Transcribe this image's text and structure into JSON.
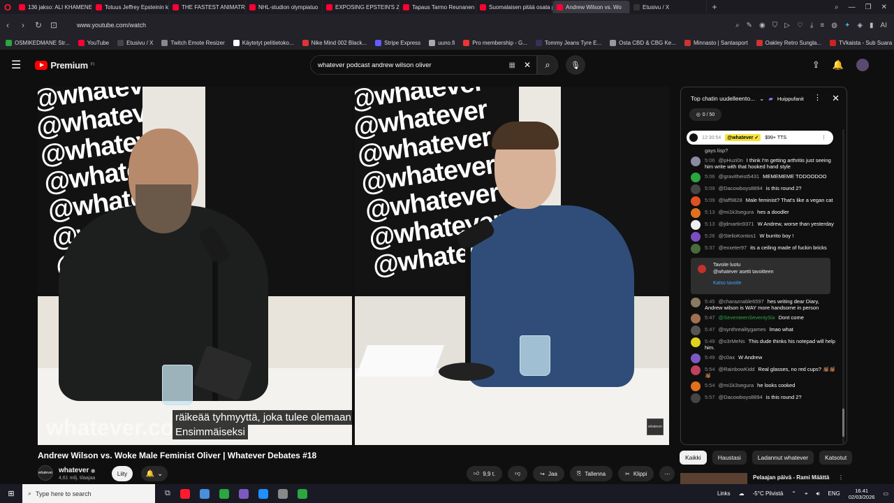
{
  "browser": {
    "tabs": [
      {
        "label": "136 jakso: ALI KHAMENEI",
        "color": "#ff0033"
      },
      {
        "label": "Totuus Jeffrey Epsteinin k",
        "color": "#ff0033"
      },
      {
        "label": "THE FASTEST ANIMATRONI",
        "color": "#ff0033"
      },
      {
        "label": "NHL-studion olympiatuo",
        "color": "#ff0033"
      },
      {
        "label": "EXPOSING EPSTEIN'S ZOR",
        "color": "#ff0033"
      },
      {
        "label": "Tapaus Tarmo Reunanen ja",
        "color": "#ff0033"
      },
      {
        "label": "Suomalaisen pitää osata p",
        "color": "#ff0033"
      },
      {
        "label": "Andrew Wilson vs. Wo",
        "color": "#ff0033",
        "active": true
      },
      {
        "label": "Etusivu / X",
        "color": "#333"
      }
    ],
    "url": "www.youtube.com/watch",
    "bookmarks": [
      {
        "label": "OSMIKEDMANE Str...",
        "color": "#2ba640"
      },
      {
        "label": "YouTube",
        "color": "#ff0033"
      },
      {
        "label": "Etusivu / X",
        "color": "#444"
      },
      {
        "label": "Twitch Emote Resizer",
        "color": "#888"
      },
      {
        "label": "Käytetyt pelitietoko...",
        "color": "#fff"
      },
      {
        "label": "Nike Mind 002 Black...",
        "color": "#d33"
      },
      {
        "label": "Stripe Express",
        "color": "#635bff"
      },
      {
        "label": "uuno.fi",
        "color": "#aaa"
      },
      {
        "label": "Pro membership - G...",
        "color": "#e33"
      },
      {
        "label": "Tommy Jeans Tyre E...",
        "color": "#335"
      },
      {
        "label": "Osta CBD & CBG Ke...",
        "color": "#999"
      },
      {
        "label": "Minnasto | Santasport",
        "color": "#c33"
      },
      {
        "label": "Oakley Retro Sungla...",
        "color": "#c33"
      },
      {
        "label": "TVkaista - Sub Suara",
        "color": "#c22"
      }
    ]
  },
  "youtube": {
    "logo": "Premium",
    "logo_sup": "FI",
    "search_value": "whatever podcast andrew wilson oliver"
  },
  "video": {
    "caption_line1": "räikeää tyhmyyttä, joka tulee olemaan",
    "caption_line2": "Ensimmäiseksi",
    "watermark": "whatever.co",
    "wall_text": "@whatever",
    "badge": "whatever",
    "title": "Andrew Wilson vs. Woke Male Feminist Oliver | Whatever Debates #18"
  },
  "channel": {
    "avatar_text": "whatever",
    "name": "whatever",
    "verified": "◉",
    "subs": "4,61 milj. tilaajaa",
    "join": "Liity",
    "like_count": "9,9 t.",
    "share": "Jaa",
    "save": "Tallenna",
    "clip": "Klippi"
  },
  "chat": {
    "header": "Top chatin uudelleento...",
    "supporters": "Huippufanit",
    "goal": "0 / 50",
    "pinned_time": "12:30:54",
    "pinned_user": "@whatever ✓",
    "pinned_text": "$99+ TTS",
    "first_line": "gays lisp?",
    "messages": [
      {
        "time": "5:06",
        "user": "@pHuzi0n",
        "text": "I think I'm getting arthritis just seeing him write with that hooked hand style",
        "color": "#8a8aa0"
      },
      {
        "time": "5:06",
        "user": "@gravitheist5431",
        "text": "MEMEMEME TODOODOO",
        "color": "#2ba640"
      },
      {
        "time": "5:09",
        "user": "@Dacowboys8894",
        "text": "is this round 2?",
        "color": "#444"
      },
      {
        "time": "5:09",
        "user": "@laff9828",
        "text": "Male feminist? That's like a vegan cat",
        "color": "#e05020"
      },
      {
        "time": "5:13",
        "user": "@mi1k3segura",
        "text": "hes a doodler",
        "color": "#e07020"
      },
      {
        "time": "5:13",
        "user": "@jdmartin9371",
        "text": "W Andrew, worse than yesterday",
        "color": "#eee"
      },
      {
        "time": "5:26",
        "user": "@StelioKontos1",
        "text": "W burrito boy !",
        "color": "#7a4ec0"
      },
      {
        "time": "5:37",
        "user": "@exxeter97",
        "text": "its a ceiling made of fuckin bricks",
        "color": "#4a6a3a"
      }
    ],
    "goal_card": {
      "line1": "Tavoite luotu",
      "line2": "@whatever asetti tavoitteen",
      "link": "Katso tavoite"
    },
    "messages2": [
      {
        "time": "5:45",
        "user": "@charaznable6597",
        "text": "hes writing dear Diary, Andrew wilson is WAY more handsome in person",
        "color": "#8a7a60",
        "member": false
      },
      {
        "time": "5:47",
        "user": "@SeventeenSeventySix",
        "text": "Dont come",
        "color": "#a07050",
        "member": true
      },
      {
        "time": "5:47",
        "user": "@synthrealitygames",
        "text": "lmao what",
        "color": "#555",
        "member": false
      },
      {
        "time": "5:49",
        "user": "@o3rMeNs",
        "text": "This dude thinks his notepad will help him.",
        "color": "#e0d020",
        "member": false
      },
      {
        "time": "5:49",
        "user": "@c0ax",
        "text": "W Andrew",
        "color": "#7a5ac0",
        "member": false
      },
      {
        "time": "5:54",
        "user": "@RainbowKidd",
        "text": "Real glasses, no red cups? 👏🏾👏🏾👏🏾",
        "color": "#c04060",
        "member": false
      },
      {
        "time": "5:54",
        "user": "@mi1k3segura",
        "text": "he looks cooked",
        "color": "#e07020",
        "member": false
      },
      {
        "time": "5:57",
        "user": "@Dacowboys8894",
        "text": "is this round 2?",
        "color": "#444",
        "member": false
      }
    ]
  },
  "chips": [
    {
      "label": "Kaikki",
      "active": true
    },
    {
      "label": "Haustasi"
    },
    {
      "label": "Ladannut whatever"
    },
    {
      "label": "Katsotut"
    }
  ],
  "recommendation": {
    "title": "Pelaajan päivä - Rami Määttä"
  },
  "taskbar": {
    "search_placeholder": "Type here to search",
    "links": "Links",
    "weather": "-5°C Pilvistä",
    "lang": "ENG",
    "time": "16.41",
    "date": "02/03/2026",
    "apps": [
      "#ff1b2d",
      "#4a8fdc",
      "#2ba640",
      "#7a5ac0",
      "#1e90ff",
      "#888",
      "#2ba640"
    ]
  }
}
